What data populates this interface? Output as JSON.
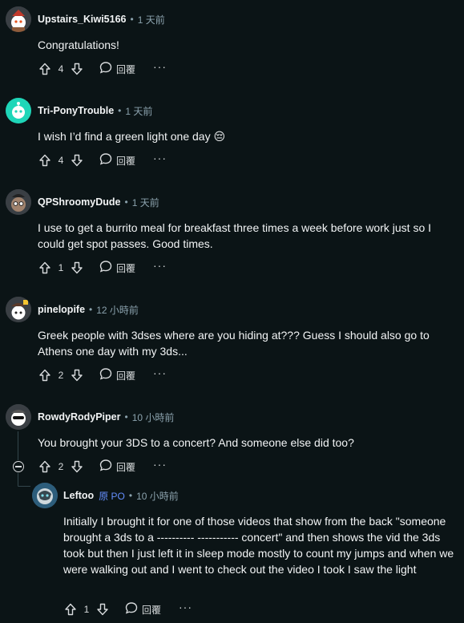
{
  "comments": [
    {
      "username": "Upstairs_Kiwi5166",
      "time": "1 天前",
      "text": "Congratulations!",
      "score": "4",
      "reply_label": "回覆",
      "more": "···"
    },
    {
      "username": "Tri-PonyTrouble",
      "time": "1 天前",
      "text": "I wish I’d find a green light one day 😔",
      "score": "4",
      "reply_label": "回覆",
      "more": "···"
    },
    {
      "username": "QPShroomyDude",
      "time": "1 天前",
      "text": "I use to get a burrito meal for breakfast three times a week before work just so I could get spot passes. Good times.",
      "score": "1",
      "reply_label": "回覆",
      "more": "···"
    },
    {
      "username": "pinelopife",
      "time": "12 小時前",
      "text": "Greek people with 3dses where are you hiding at??? Guess I should also go to Athens one day with my 3ds...",
      "score": "2",
      "reply_label": "回覆",
      "more": "···"
    },
    {
      "username": "RowdyRodyPiper",
      "time": "10 小時前",
      "text": "You brought your 3DS to a concert? And someone else did too?",
      "score": "2",
      "reply_label": "回覆",
      "more": "···"
    },
    {
      "username": "Leftoo",
      "op_label": "原 PO",
      "time": "10 小時前",
      "text": "Initially I brought it for one of those videos that show from the back \"someone brought a 3ds to a ---------- ----------- concert\" and then shows the vid the 3ds took but then I just left it in sleep mode mostly to count my jumps and when we were walking out and I went to check out the video I took I saw the light",
      "score": "1",
      "reply_label": "回覆",
      "more": "···"
    }
  ],
  "separator": "•",
  "colors": {
    "background": "#0b1416",
    "text": "#f2f4f5",
    "muted": "#8ba2ad",
    "op": "#648efc"
  }
}
